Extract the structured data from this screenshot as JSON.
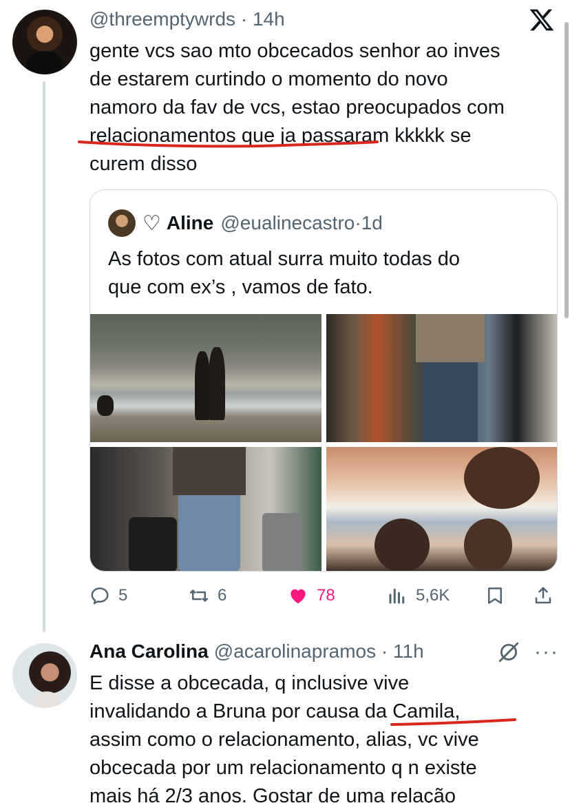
{
  "tweet1": {
    "handle": "@threemptywrds",
    "separator": " · ",
    "time": "14h",
    "text_lines": [
      "gente vcs sao mto obcecados senhor ao inves",
      "de estarem curtindo o momento do novo",
      "namoro da fav de vcs, estao preocupados com",
      "relacionamentos que ja passaram kkkkk se",
      "curem disso"
    ],
    "quote": {
      "name": "Aline",
      "handle": "@eualinecastro",
      "separator": " · ",
      "time": "1d",
      "heart_glyph": "♡",
      "text_lines": [
        "As fotos com atual surra muito todas do",
        "que com ex’s , vamos de fato."
      ]
    },
    "actions": {
      "replies": "5",
      "retweets": "6",
      "likes": "78",
      "views": "5,6K"
    }
  },
  "tweet2": {
    "name": "Ana Carolina",
    "handle": "@acarolinapramos",
    "separator": " · ",
    "time": "11h",
    "more": "···",
    "text_lines": [
      "E disse a obcecada, q inclusive vive",
      "invalidando a Bruna por causa da Camila,",
      "assim como o relacionamento, alias, vc vive",
      "obcecada por um relacionamento q n existe",
      "mais há 2/3 anos. Gostar de uma relação"
    ]
  },
  "colors": {
    "text": "#0f1419",
    "secondary": "#536471",
    "like": "#f91880",
    "annotation": "#d8261c",
    "border": "#cfd9de"
  },
  "icons": [
    "x-logo-icon",
    "reply-icon",
    "retweet-icon",
    "heart-icon",
    "views-icon",
    "bookmark-icon",
    "share-icon",
    "grok-icon",
    "more-icon"
  ]
}
